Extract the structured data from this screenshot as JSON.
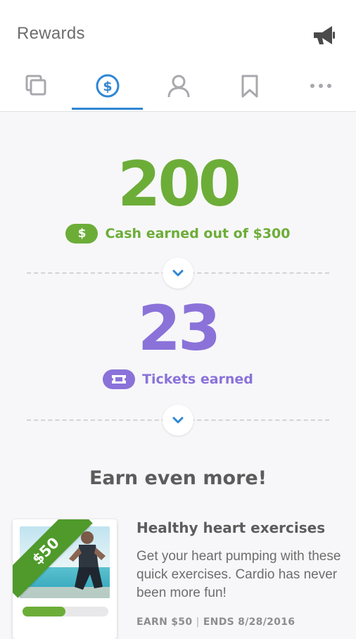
{
  "header": {
    "title": "Rewards",
    "tabs": [
      {
        "icon": "copy-icon",
        "active": false
      },
      {
        "icon": "dollar-circle-icon",
        "active": true
      },
      {
        "icon": "person-icon",
        "active": false
      },
      {
        "icon": "bookmark-icon",
        "active": false
      },
      {
        "icon": "more-icon",
        "active": false
      }
    ]
  },
  "cash": {
    "value": "200",
    "label": "Cash earned out of $300",
    "badge_symbol": "$",
    "color": "#6cad38"
  },
  "tickets": {
    "value": "23",
    "label": "Tickets earned",
    "color": "#8a72d9"
  },
  "section_title": "Earn even more!",
  "offer": {
    "badge": "$50",
    "title": "Healthy heart exercises",
    "description": "Get your heart pumping with these quick exercises. Cardio has never been more fun!",
    "earn": "EARN $50",
    "separator": "|",
    "ends": "ENDS 8/28/2016",
    "progress": 0.5
  },
  "colors": {
    "accent_blue": "#2f86d4",
    "green": "#6cad38",
    "purple": "#8a72d9",
    "icon_gray": "#a8a8ad"
  }
}
